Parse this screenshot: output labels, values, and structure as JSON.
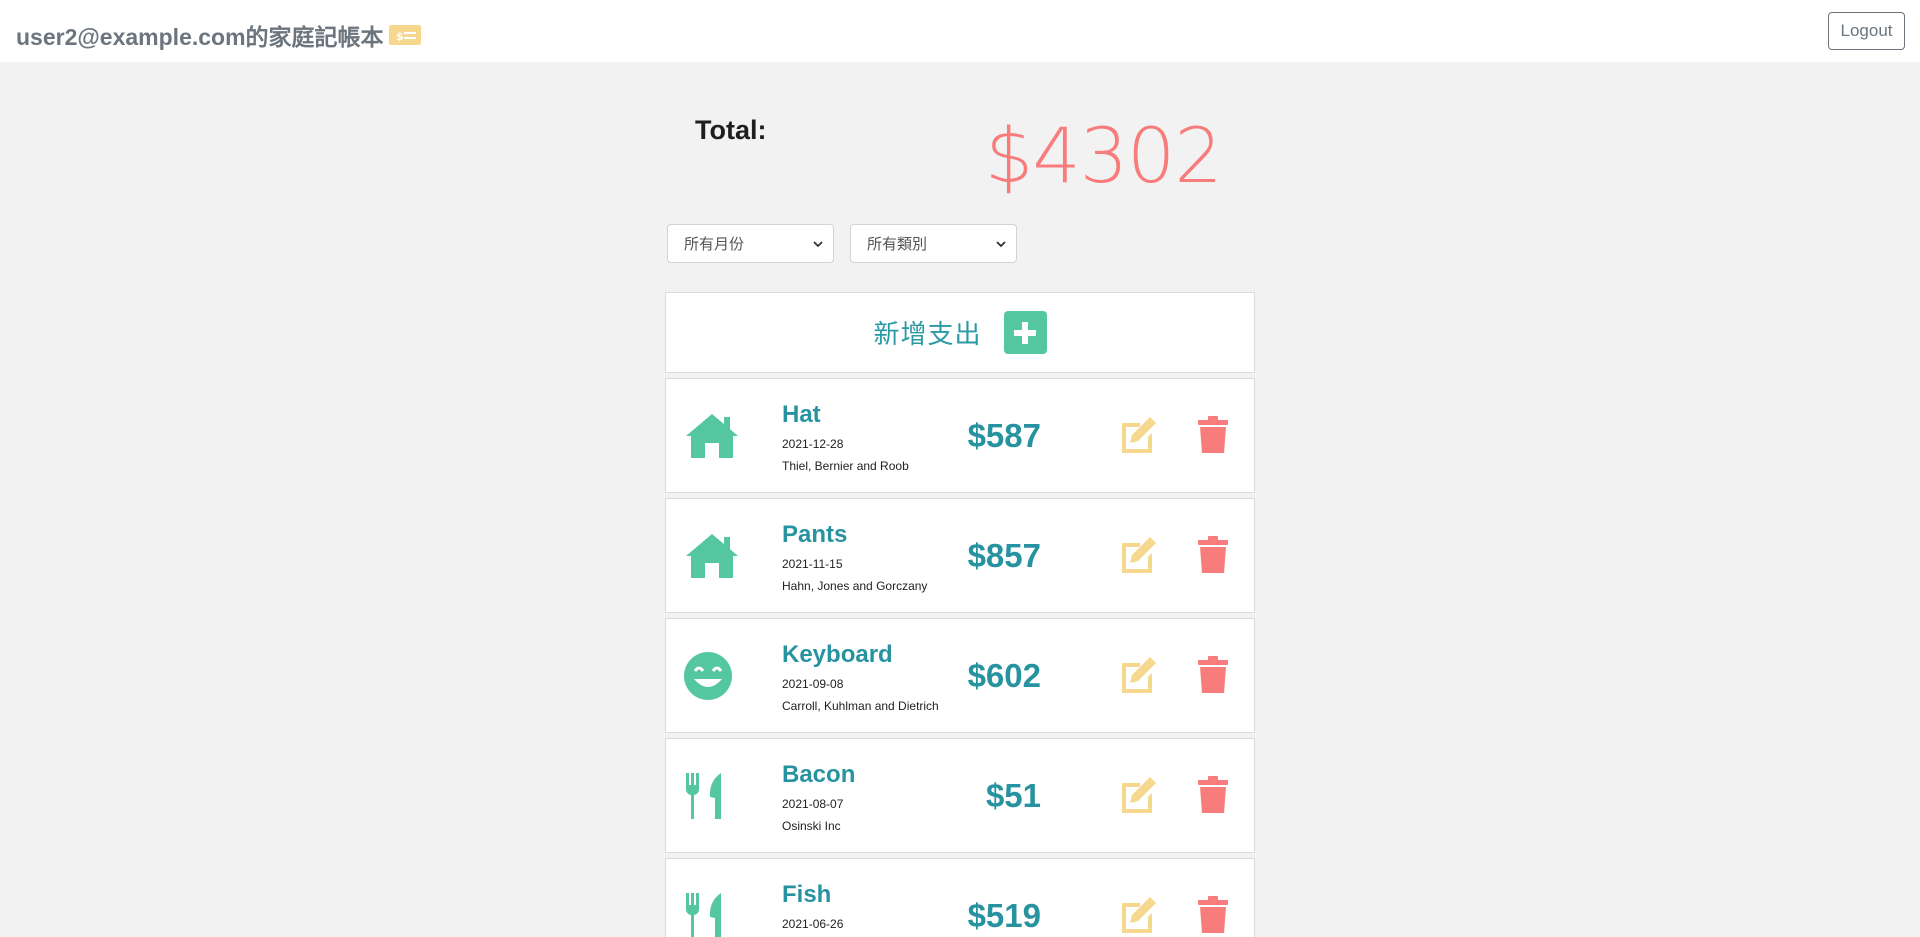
{
  "header": {
    "title": "user2@example.com的家庭記帳本",
    "logout_label": "Logout"
  },
  "summary": {
    "total_label": "Total:",
    "total_value": "$4302"
  },
  "filters": {
    "month": "所有月份",
    "category": "所有類別"
  },
  "add": {
    "label": "新增支出"
  },
  "records": [
    {
      "icon": "house-icon",
      "name": "Hat",
      "date": "2021-12-28",
      "vendor": "Thiel, Bernier and Roob",
      "amount": "$587"
    },
    {
      "icon": "house-icon",
      "name": "Pants",
      "date": "2021-11-15",
      "vendor": "Hahn, Jones and Gorczany",
      "amount": "$857"
    },
    {
      "icon": "smile-icon",
      "name": "Keyboard",
      "date": "2021-09-08",
      "vendor": "Carroll, Kuhlman and Dietrich",
      "amount": "$602"
    },
    {
      "icon": "utensils-icon",
      "name": "Bacon",
      "date": "2021-08-07",
      "vendor": "Osinski Inc",
      "amount": "$51"
    },
    {
      "icon": "utensils-icon",
      "name": "Fish",
      "date": "2021-06-26",
      "vendor": "",
      "amount": "$519"
    }
  ],
  "colors": {
    "accent": "#2793a0",
    "icon_green": "#55c7a0",
    "edit_yellow": "#f5d78e",
    "delete_red": "#f87c7c",
    "total_red": "#f87c7c"
  }
}
